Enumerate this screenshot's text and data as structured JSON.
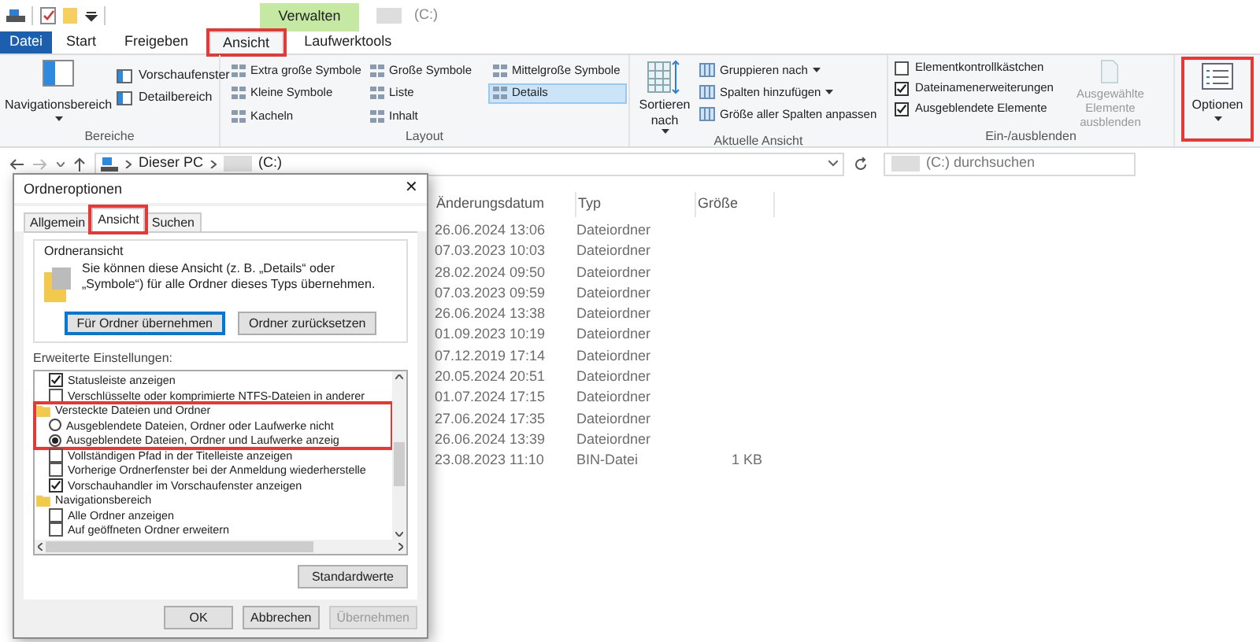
{
  "window": {
    "title": "(C:)",
    "context_tab": "Verwalten"
  },
  "ribbon_tabs": [
    {
      "label": "Datei",
      "kind": "file",
      "selected": false,
      "highlighted": false
    },
    {
      "label": "Start",
      "kind": "tab",
      "selected": false,
      "highlighted": false
    },
    {
      "label": "Freigeben",
      "kind": "tab",
      "selected": false,
      "highlighted": false
    },
    {
      "label": "Ansicht",
      "kind": "tab",
      "selected": true,
      "highlighted": true
    },
    {
      "label": "Laufwerktools",
      "kind": "tab",
      "selected": false,
      "highlighted": false
    }
  ],
  "panes": {
    "label": "Bereiche",
    "navigation": "Navigationsbereich",
    "items": [
      "Vorschaufenster",
      "Detailbereich"
    ]
  },
  "layout": {
    "label": "Layout",
    "options": [
      {
        "label": "Extra große Symbole",
        "selected": false
      },
      {
        "label": "Kleine Symbole",
        "selected": false
      },
      {
        "label": "Kacheln",
        "selected": false
      },
      {
        "label": "Große Symbole",
        "selected": false
      },
      {
        "label": "Liste",
        "selected": false
      },
      {
        "label": "Inhalt",
        "selected": false
      },
      {
        "label": "Mittelgroße Symbole",
        "selected": false
      },
      {
        "label": "Details",
        "selected": true
      }
    ]
  },
  "current_view": {
    "label": "Aktuelle Ansicht",
    "sort": "Sortieren nach",
    "items": [
      {
        "label": "Gruppieren nach",
        "dropdown": true
      },
      {
        "label": "Spalten hinzufügen",
        "dropdown": true
      },
      {
        "label": "Größe aller Spalten anpassen",
        "dropdown": false
      }
    ]
  },
  "show_hide": {
    "label": "Ein-/ausblenden",
    "checkboxes": [
      {
        "label": "Elementkontrollkästchen",
        "checked": false
      },
      {
        "label": "Dateinamenerweiterungen",
        "checked": true
      },
      {
        "label": "Ausgeblendete Elemente",
        "checked": true
      }
    ],
    "hide_selected": {
      "label": "Ausgewählte Elemente ausblenden",
      "disabled": true
    }
  },
  "options_button": {
    "label": "Optionen",
    "highlighted": true
  },
  "address": {
    "crumbs": [
      "Dieser PC",
      "(C:)"
    ]
  },
  "search": {
    "placeholder": "(C:) durchsuchen"
  },
  "file_list": {
    "columns": [
      "Änderungsdatum",
      "Typ",
      "Größe"
    ],
    "rows": [
      {
        "date": "26.06.2024 13:06",
        "type": "Dateiordner"
      },
      {
        "date": "07.03.2023 10:03",
        "type": "Dateiordner"
      },
      {
        "date": "28.02.2024 09:50",
        "type": "Dateiordner"
      },
      {
        "date": "07.03.2023 09:59",
        "type": "Dateiordner"
      },
      {
        "date": "26.06.2024 13:38",
        "type": "Dateiordner"
      },
      {
        "date": "01.09.2023 10:19",
        "type": "Dateiordner"
      },
      {
        "date": "07.12.2019 17:14",
        "type": "Dateiordner"
      },
      {
        "date": "20.05.2024 20:51",
        "type": "Dateiordner"
      },
      {
        "date": "01.07.2024 17:15",
        "type": "Dateiordner"
      },
      {
        "date": "27.06.2024 17:35",
        "type": "Dateiordner"
      },
      {
        "date": "26.06.2024 13:39",
        "type": "Dateiordner"
      },
      {
        "date": "23.08.2023 11:10",
        "type": "BIN-Datei",
        "size": "1 KB"
      }
    ]
  },
  "dialog": {
    "title": "Ordneroptionen",
    "close": "✕",
    "tabs": [
      {
        "label": "Allgemein",
        "selected": false,
        "highlighted": false
      },
      {
        "label": "Ansicht",
        "selected": true,
        "highlighted": true
      },
      {
        "label": "Suchen",
        "selected": false,
        "highlighted": false
      }
    ],
    "folder_view": {
      "label": "Ordneransicht",
      "text": "Sie können diese Ansicht (z. B. „Details“ oder „Symbole“) für alle Ordner dieses Typs übernehmen.",
      "buttons": [
        {
          "label": "Für Ordner übernehmen",
          "default": true
        },
        {
          "label": "Ordner zurücksetzen",
          "default": false
        }
      ]
    },
    "advanced_label": "Erweiterte Einstellungen:",
    "settings": [
      {
        "kind": "checkbox",
        "label": "Statusleiste anzeigen",
        "checked": true
      },
      {
        "kind": "checkbox",
        "label": "Verschlüsselte oder komprimierte NTFS-Dateien in anderer",
        "checked": false
      },
      {
        "kind": "folder",
        "label": "Versteckte Dateien und Ordner",
        "highlighted": true,
        "children": [
          {
            "kind": "radio",
            "label": "Ausgeblendete Dateien, Ordner oder Laufwerke nicht",
            "selected": false
          },
          {
            "kind": "radio",
            "label": "Ausgeblendete Dateien, Ordner und Laufwerke anzeig",
            "selected": true
          }
        ]
      },
      {
        "kind": "checkbox",
        "label": "Vollständigen Pfad in der Titelleiste anzeigen",
        "checked": false
      },
      {
        "kind": "checkbox",
        "label": "Vorherige Ordnerfenster bei der Anmeldung wiederherstelle",
        "checked": false
      },
      {
        "kind": "checkbox",
        "label": "Vorschauhandler im Vorschaufenster anzeigen",
        "checked": true
      },
      {
        "kind": "folder",
        "label": "Navigationsbereich",
        "highlighted": false,
        "children": [
          {
            "kind": "checkbox",
            "label": "Alle Ordner anzeigen",
            "checked": false
          },
          {
            "kind": "checkbox",
            "label": "Auf geöffneten Ordner erweitern",
            "checked": false
          }
        ]
      }
    ],
    "defaults_button": "Standardwerte",
    "buttons": [
      {
        "label": "OK",
        "disabled": false
      },
      {
        "label": "Abbrechen",
        "disabled": false
      },
      {
        "label": "Übernehmen",
        "disabled": true
      }
    ]
  }
}
